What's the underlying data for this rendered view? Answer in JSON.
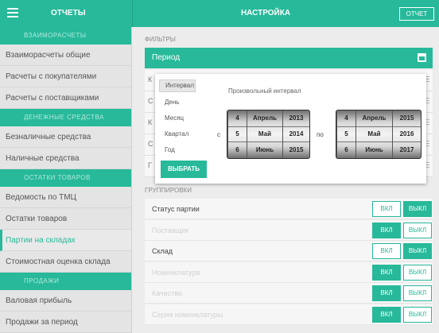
{
  "header": {
    "left_title": "ОТЧЕТЫ",
    "center_title": "НАСТРОЙКА",
    "right_button": "ОТЧЕТ"
  },
  "sidebar": {
    "sections": [
      "ВЗАИМОРАСЧЕТЫ",
      "ДЕНЕЖНЫЕ СРЕДСТВА",
      "ОСТАТКИ ТОВАРОВ",
      "ПРОДАЖИ"
    ],
    "items": [
      "Взаиморасчеты общие",
      "Расчеты с покупателями",
      "Расчеты с поставщиками",
      "Безналичные средства",
      "Наличные средства",
      "Ведомость по ТМЦ",
      "Остатки товаров",
      "Партии на складах",
      "Стоимостная оценка склада",
      "Валовая прибыль",
      "Продажи за период"
    ],
    "active_item": "Партии на складах"
  },
  "filters": {
    "label": "ФИЛЬТРЫ",
    "period_label": "Период",
    "ghost_letters": [
      "К",
      "С",
      "К",
      "С",
      "Г"
    ]
  },
  "period_popup": {
    "options": [
      "Интервал",
      "День",
      "Месяц",
      "Квартал",
      "Год"
    ],
    "selected_option": "Интервал",
    "title": "Произвольный интервал",
    "from_label": "с",
    "to_label": "по",
    "from_wheel": {
      "days": [
        "4",
        "5",
        "6"
      ],
      "months": [
        "Апрель",
        "Май",
        "Июнь"
      ],
      "years": [
        "2013",
        "2014",
        "2015"
      ]
    },
    "to_wheel": {
      "days": [
        "4",
        "5",
        "6"
      ],
      "months": [
        "Апрель",
        "Май",
        "Июнь"
      ],
      "years": [
        "2015",
        "2016",
        "2017"
      ]
    },
    "choose_button": "ВЫБРАТЬ"
  },
  "groupings": {
    "label": "ГРУППИРОВКИ",
    "on_label": "ВКЛ",
    "off_label": "ВЫКЛ",
    "rows": [
      {
        "name": "Статус партии",
        "state": "off",
        "dim": false
      },
      {
        "name": "Поставщик",
        "state": "on",
        "dim": true
      },
      {
        "name": "Склад",
        "state": "off",
        "dim": false
      },
      {
        "name": "Номенклатура",
        "state": "on",
        "dim": true
      },
      {
        "name": "Качество",
        "state": "on",
        "dim": true
      },
      {
        "name": "Серия номенклатуры",
        "state": "on",
        "dim": true
      }
    ]
  },
  "colors": {
    "accent": "#27b99a"
  }
}
